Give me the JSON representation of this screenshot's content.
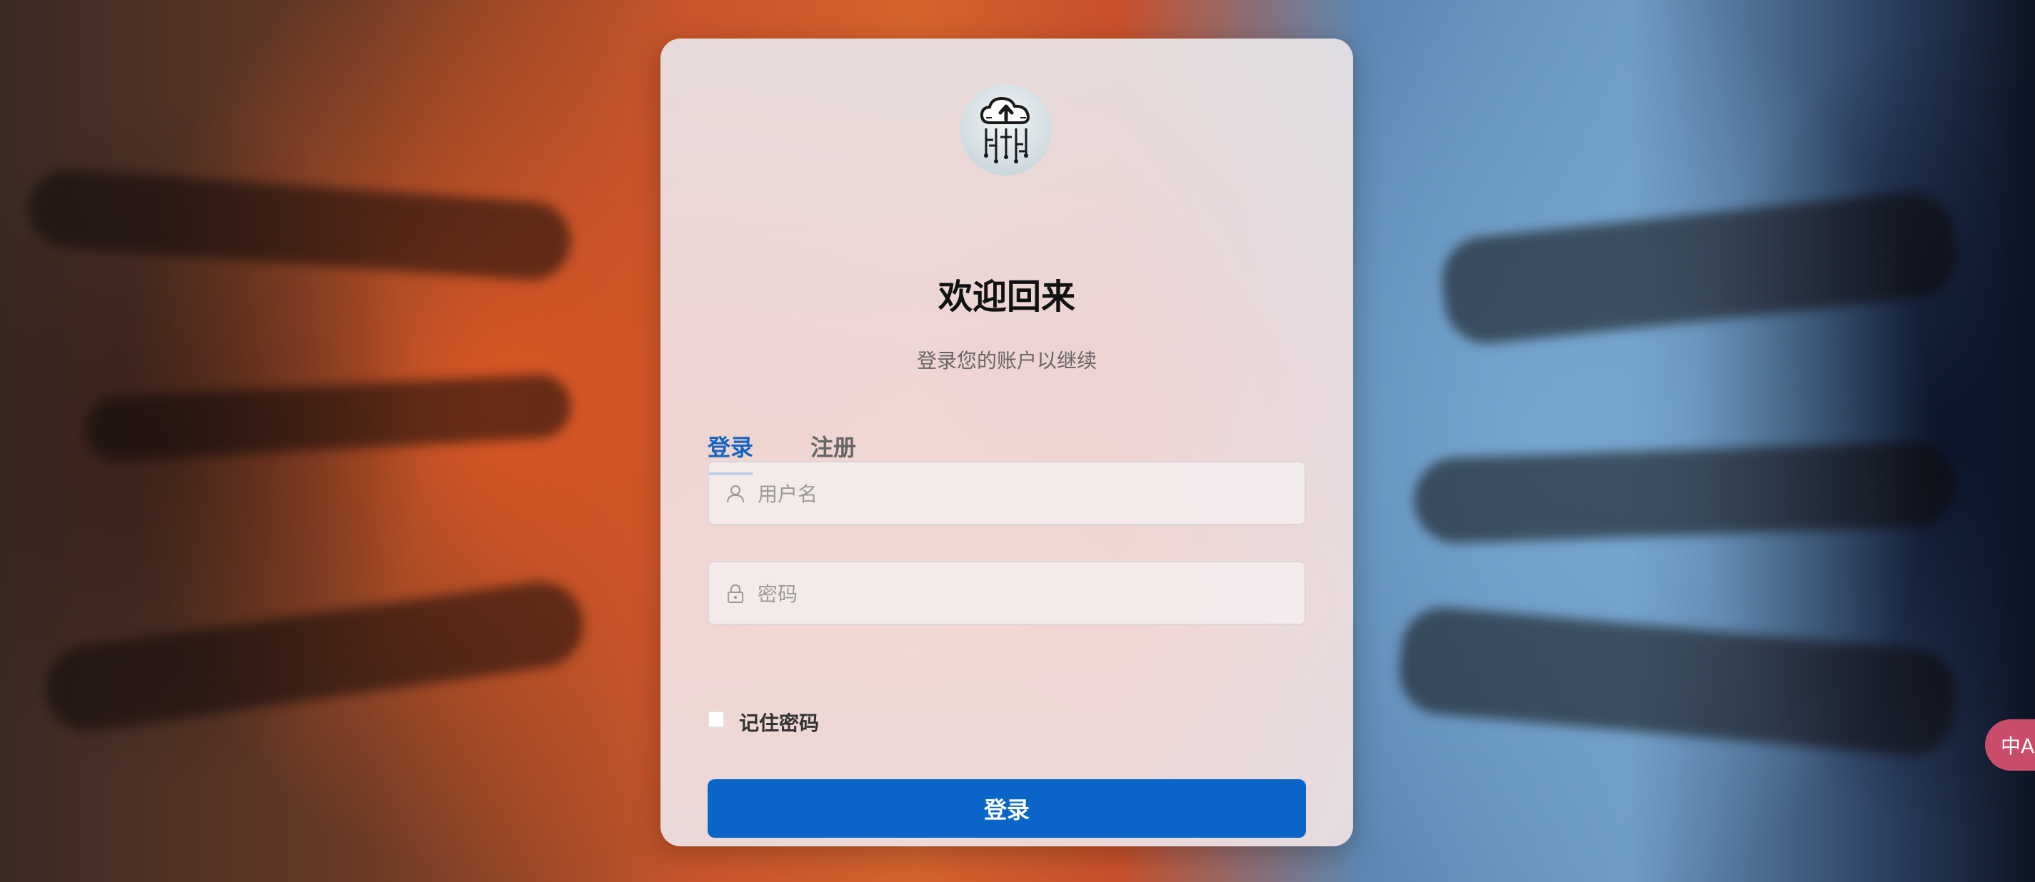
{
  "login": {
    "title": "欢迎回来",
    "subtitle": "登录您的账户以继续",
    "tabs": [
      {
        "label": "登录",
        "active": true
      },
      {
        "label": "注册",
        "active": false
      }
    ],
    "username": {
      "placeholder": "用户名",
      "value": ""
    },
    "password": {
      "placeholder": "密码",
      "value": ""
    },
    "remember_label": "记住密码",
    "remember_checked": false,
    "submit_label": "登录"
  },
  "logo": {
    "icon": "cloud-upload-circuit-icon"
  },
  "translate_widget": {
    "icon": "translate-icon",
    "glyph": "中A"
  },
  "colors": {
    "primary": "#0a65c8",
    "tab_active": "#1565c0",
    "translate_bg": "#c94d6a"
  }
}
